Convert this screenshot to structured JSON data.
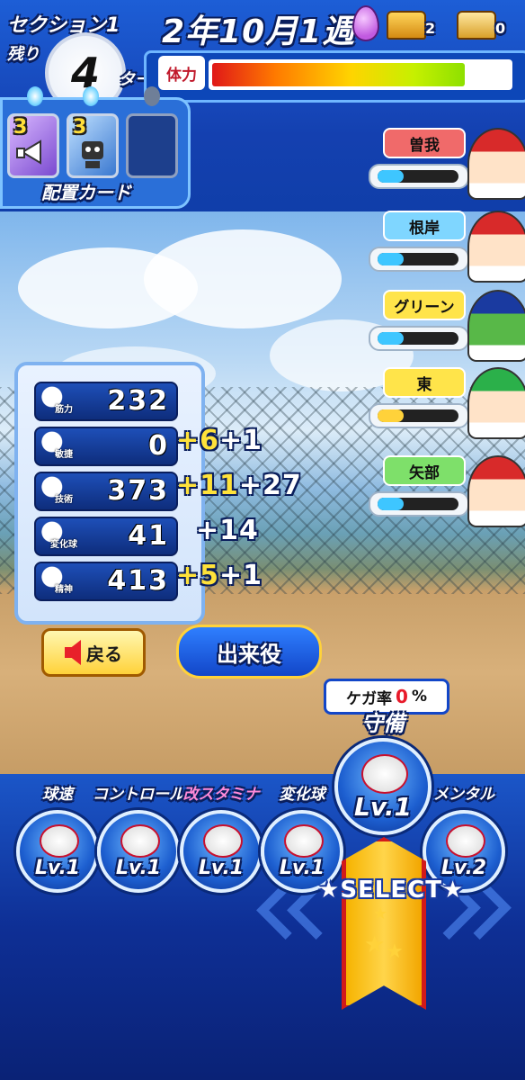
{
  "header": {
    "section_label": "セクション1",
    "remaining_label": "残り",
    "turns_left": "4",
    "turn_unit": "ターン",
    "date": "2年10月1週",
    "chest_gold_count": "2",
    "chest_open_count": "0"
  },
  "stamina": {
    "label": "体力",
    "level": 0.85
  },
  "cards": {
    "label": "配置カード",
    "slots": [
      {
        "count": "3",
        "icon": "megaphone-icon"
      },
      {
        "count": "3",
        "icon": "robot-icon"
      },
      {
        "count": "",
        "icon": "empty-slot"
      }
    ]
  },
  "teammates": [
    {
      "name": "曽我",
      "color": "#f06a6a",
      "level": 0.32,
      "fill": "#3ec6ff"
    },
    {
      "name": "根岸",
      "color": "#7fd6ff",
      "level": 0.32,
      "fill": "#3ec6ff"
    },
    {
      "name": "グリーン",
      "color": "#ffe44a",
      "level": 0.32,
      "fill": "#3ec6ff"
    },
    {
      "name": "東",
      "color": "#ffe44a",
      "level": 0.32,
      "fill": "#ffd23a"
    },
    {
      "name": "矢部",
      "color": "#7ee06a",
      "level": 0.32,
      "fill": "#3ec6ff"
    }
  ],
  "stats": [
    {
      "label": "筋力",
      "icon": "dumbbell-icon",
      "value": "232",
      "bonus1": "",
      "bonus2": ""
    },
    {
      "label": "敏捷",
      "icon": "spike-shoe-icon",
      "value": "0",
      "bonus1": "6",
      "bonus2": "1"
    },
    {
      "label": "技術",
      "icon": "bat-icon",
      "value": "373",
      "bonus1": "11",
      "bonus2": "27"
    },
    {
      "label": "変化球",
      "icon": "breaking-ball-icon",
      "value": "41",
      "bonus1": "",
      "bonus2": "14"
    },
    {
      "label": "精神",
      "icon": "spirit-icon",
      "value": "413",
      "bonus1": "5",
      "bonus2": "1"
    }
  ],
  "buttons": {
    "back": "戻る",
    "events": "出来役"
  },
  "injury": {
    "label": "ケガ率",
    "value": "0",
    "unit": "%"
  },
  "skills": [
    {
      "name": "球速",
      "level": "Lv.1",
      "icon": "fastball-icon"
    },
    {
      "name": "コントロール",
      "level": "Lv.1",
      "icon": "target-icon"
    },
    {
      "name": "改スタミナ",
      "level": "Lv.1",
      "icon": "tire-icon"
    },
    {
      "name": "変化球",
      "level": "Lv.1",
      "icon": "curve-ball-icon"
    },
    {
      "name": "守備",
      "level": "Lv.1",
      "icon": "glove-icon"
    },
    {
      "name": "メンタル",
      "level": "Lv.2",
      "icon": "mental-icon"
    }
  ],
  "select_label": "SELECT"
}
